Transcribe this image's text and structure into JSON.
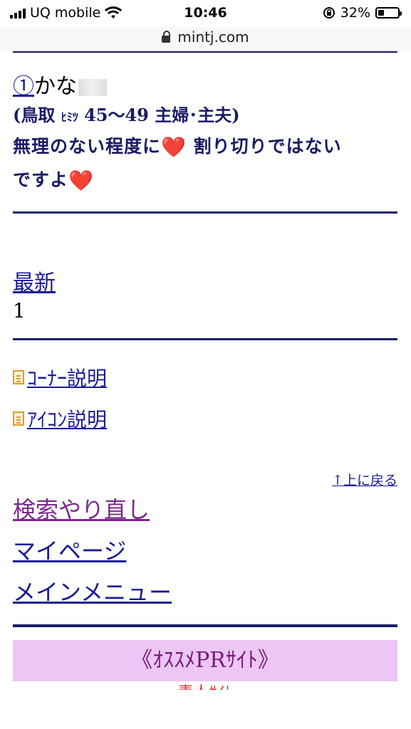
{
  "status_bar": {
    "carrier": "UQ mobile",
    "time": "10:46",
    "battery": "32%",
    "battery_level": 0.32
  },
  "browser": {
    "url": "mintj.com"
  },
  "post": {
    "rank": "①",
    "name": "かな",
    "meta_open": "(鳥取 ",
    "meta_small": "ﾋﾐﾂ",
    "meta_rest": " 45〜49 主婦･主夫)",
    "message_part1": "無理のない程度に",
    "message_part2": " 割り切りではない",
    "message_part3": "ですよ",
    "heart_emoji": "❤️"
  },
  "pager": {
    "newest_label": "最新",
    "page_number": "1"
  },
  "links": {
    "corner_desc": "ｺｰﾅｰ説明",
    "icon_desc": "ｱｲｺﾝ説明",
    "back_to_top": "↑上に戻る"
  },
  "menu": {
    "search_again": "検索やり直し",
    "my_page": "マイページ",
    "main_menu": "メインメニュー"
  },
  "pr": {
    "title": "《ｵｽｽﾒPRｻｲﾄ》",
    "next_line": "素人ｻｲﾄ"
  }
}
